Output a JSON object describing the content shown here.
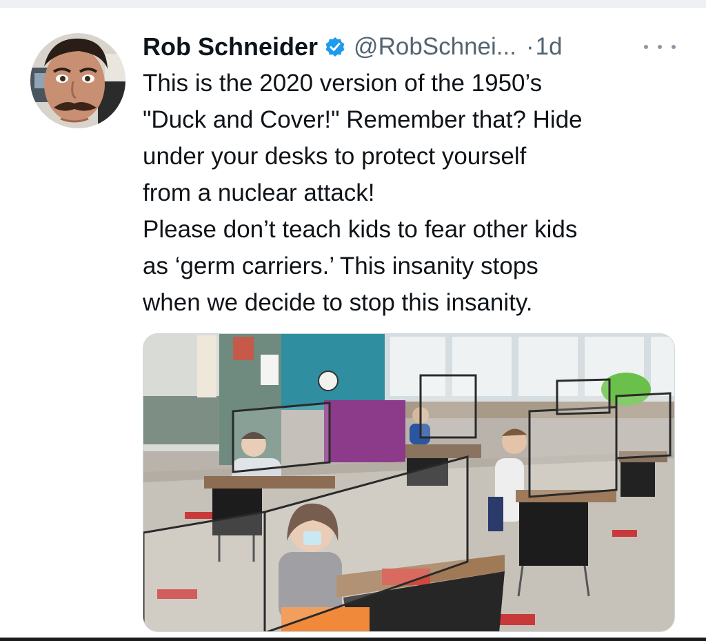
{
  "tweet": {
    "display_name": "Rob Schneider",
    "handle": "@RobSchnei...",
    "separator": "·",
    "timestamp": "1d",
    "text_lines": [
      "This is the 2020 version of the 1950’s",
      "\"Duck and Cover!\" Remember that? Hide",
      "under your desks to protect yourself",
      "from a nuclear attack!",
      "Please don’t teach kids to fear other kids",
      "as ‘germ carriers.’ This insanity stops",
      "when we decide to stop this insanity."
    ],
    "verified": true
  },
  "icons": {
    "verified": "verified-badge-icon",
    "more": "more-options-icon"
  },
  "colors": {
    "verified_blue": "#1d9bf0",
    "text_primary": "#0f1419",
    "text_secondary": "#536471"
  }
}
